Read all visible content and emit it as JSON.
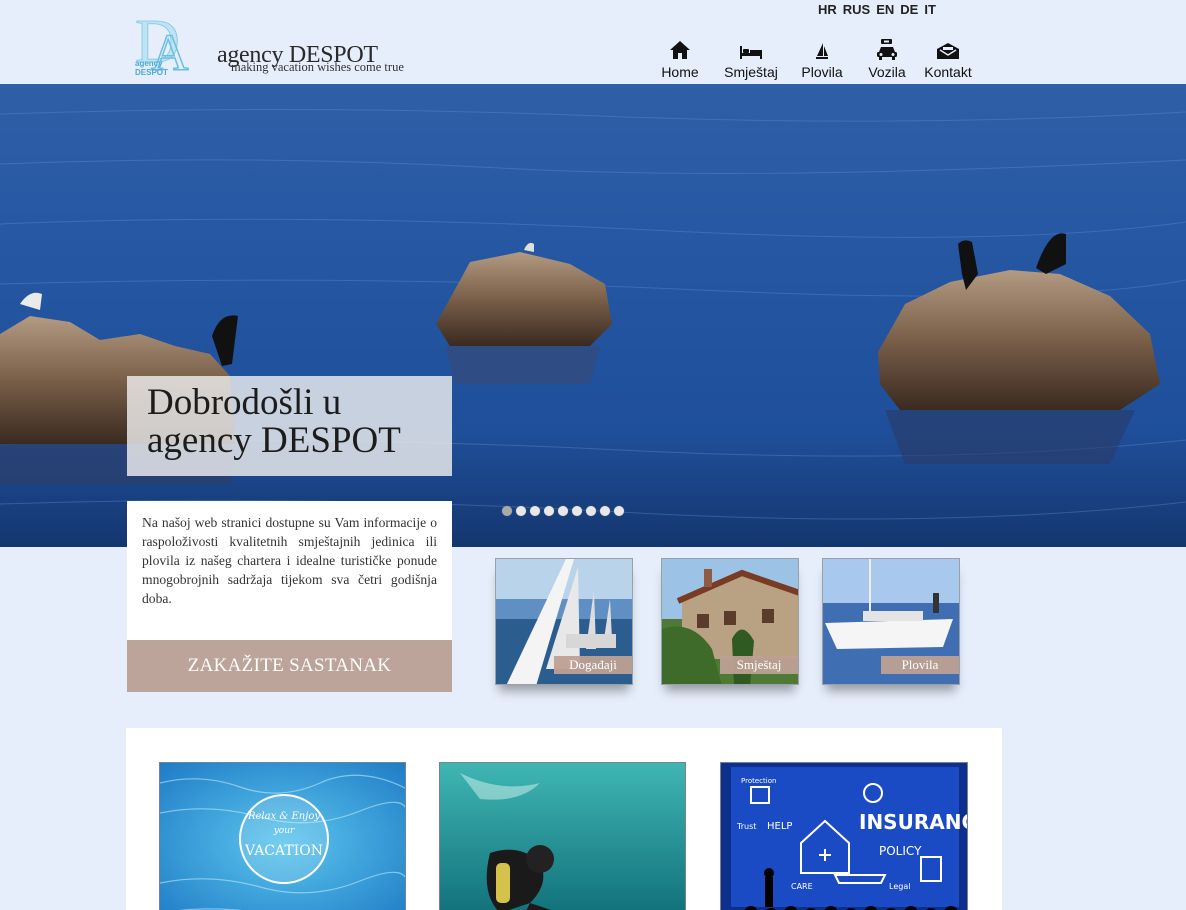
{
  "brand": {
    "name": "agency DESPOT",
    "tagline": "making vacation wishes come true",
    "logo_letters": "DA",
    "logo_small_text": "agency DESPOT"
  },
  "languages": [
    "HR",
    "RUS",
    "EN",
    "DE",
    "IT"
  ],
  "nav": [
    {
      "label": "Home",
      "icon": "home-icon"
    },
    {
      "label": "Smještaj",
      "icon": "bed-icon"
    },
    {
      "label": "Plovila",
      "icon": "sailboat-icon"
    },
    {
      "label": "Vozila",
      "icon": "car-icon"
    },
    {
      "label": "Kontakt",
      "icon": "envelope-icon"
    }
  ],
  "hero": {
    "title_line1": "Dobrodošli u",
    "title_line2": "agency DESPOT",
    "slide_count": 9,
    "active_slide": 1
  },
  "intro": {
    "text": "Na našoj web stranici dostupne su Vam informacije o raspoloživosti kvalitetnih smještajnih jedinica ili plovila iz našeg chartera i idealne turističke ponude mnogobrojnih sadržaja tijekom sva četri godišnja doba.",
    "cta_label": "ZAKAŽITE SASTANAK"
  },
  "thumbs": [
    {
      "caption": "Događaji"
    },
    {
      "caption": "Smještaj"
    },
    {
      "caption": "Plovila"
    }
  ],
  "cards": [
    {
      "image": "vacation-badge-pool",
      "badge_line1": "Relax & Enjoy",
      "badge_line2": "your",
      "badge_line3": "VACATION"
    },
    {
      "image": "scuba-diver"
    },
    {
      "image": "insurance-policy",
      "words": [
        "INSURANCE",
        "POLICY",
        "HELP",
        "Trust",
        "Legal",
        "CARE",
        "Protection"
      ]
    }
  ],
  "colors": {
    "page_bg": "#e6eefb",
    "accent": "#bca49a",
    "text": "#1c1c1c"
  }
}
